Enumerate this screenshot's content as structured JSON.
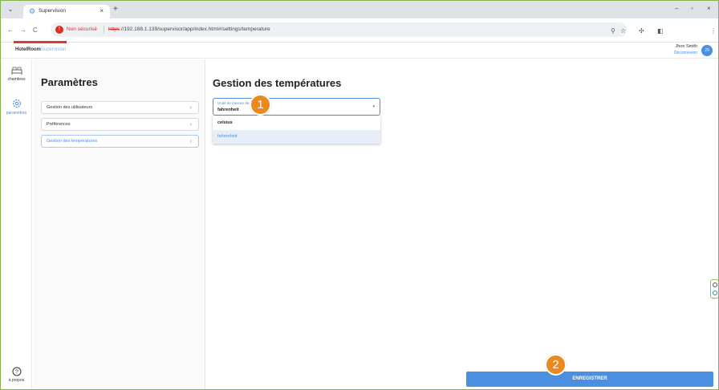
{
  "browser": {
    "tab_title": "Supervision",
    "tab_close": "×",
    "new_tab": "+",
    "tab_menu": "⌄",
    "win_minimize": "–",
    "win_restore": "▫",
    "win_close": "×",
    "back": "←",
    "forward": "→",
    "reload": "C",
    "security_label": "Non sécurisé",
    "url_protocol": "https",
    "url_rest": "://192.168.1.139/supervisor/app/index.html#/settings/temperature",
    "icons": [
      "zoom-icon",
      "star-icon",
      "extension-icon",
      "sidepanel-icon",
      "kebab-icon"
    ]
  },
  "app": {
    "brand_main": "HotelRoom",
    "brand_sub": "Supervision",
    "user_name": "Jhon Smith",
    "logout": "Déconnexion",
    "avatar_initials": "JS",
    "accent_color": "#4a8fe0",
    "underline_color": "#d93a3a"
  },
  "rail": {
    "items": [
      {
        "label": "chambres",
        "icon": "bed-icon"
      },
      {
        "label": "paramètres",
        "icon": "gear-icon"
      }
    ],
    "about_label": "à propos",
    "about_icon": "help-circle-icon"
  },
  "settings": {
    "title": "Paramètres",
    "items": [
      {
        "label": "Gestion des utilisateurs",
        "active": false
      },
      {
        "label": "Préférences",
        "active": false
      },
      {
        "label": "Gestion des températures",
        "active": true
      }
    ],
    "chevron": "›"
  },
  "main": {
    "title": "Gestion des températures",
    "select": {
      "label": "Unité de mesure de",
      "value": "fahrenheit",
      "caret": "▾",
      "options": [
        {
          "label": "celsius",
          "selected": false
        },
        {
          "label": "fahrenheit",
          "selected": true
        }
      ]
    },
    "save_label": "ENREGISTRER"
  },
  "callouts": [
    "1",
    "2"
  ],
  "callout_color": "#e9891e"
}
